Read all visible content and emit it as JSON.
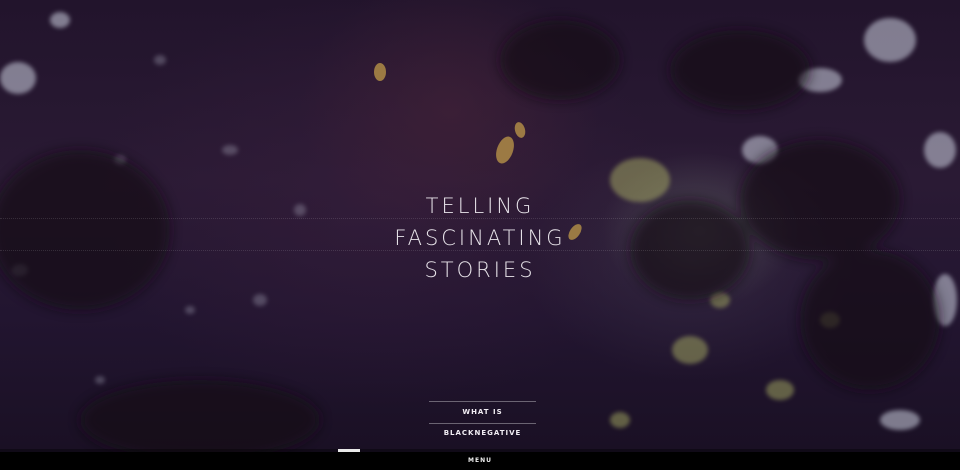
{
  "hero": {
    "headline": [
      "TELLING",
      "FASCINATING",
      "STORIES"
    ],
    "cta_label": "WHAT IS BLACKNEGATIVE",
    "background_image": "forest-canopy-photo"
  },
  "slider": {
    "progress_fraction": 0.0,
    "indicator_start_fraction": 0.352,
    "indicator_width_fraction": 0.023
  },
  "footer": {
    "menu_label": "MENU"
  },
  "colors": {
    "hero_overlay": "#241630",
    "text": "#e8e4ea",
    "menu_bar": "#000000"
  }
}
